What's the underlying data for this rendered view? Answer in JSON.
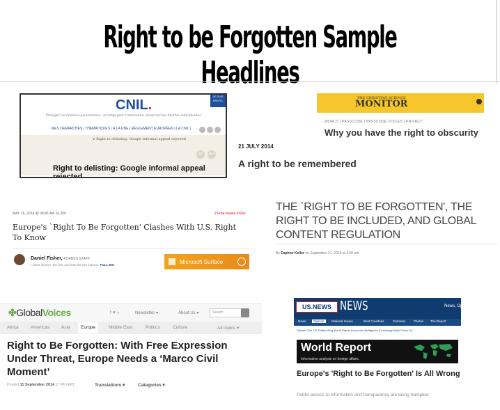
{
  "title": "Right to be Forgotten Sample Headlines",
  "cnil": {
    "logo": "CNIL",
    "logo_dot": ".",
    "corner_text": "JE SUIS PARTIC",
    "tagline": "Protéger les données personnelles, accompagner l'innovation, préserver les libertés individuelles",
    "nav": "MES DÉMARCHES | THÉMATIQUES | À LA UNE | RÈGLEMENT EUROPÉEN | LA CNIL |",
    "breadcrumb": "▸ Right to delisting: Google informal appeal rejected",
    "font_minus": "A-",
    "font_plus": "A+",
    "headline": "Right to delisting: Google informal appeal rejected"
  },
  "csm": {
    "logo_small": "THE CHRISTIAN SCIENCE",
    "logo": "MONITOR",
    "nav": "WORLD | PASSCODE | PASSCODE VOICES | PRIVACY",
    "headline": "Why you have the right to obscurity",
    "brand_color": "#f7c62a"
  },
  "standalone": {
    "date": "21 JULY 2014",
    "headline": "A right to be remembered"
  },
  "forbes": {
    "meta": "MAY 16, 2014 @ 08:45 AM    16,306",
    "free": "2 Free Issues of For",
    "headline": "Europe's `Right To Be Forgotten' Clashes With U.S. Right To Know",
    "author": "Daniel Fisher,",
    "staff": "FORBES STAFF",
    "bio": "I cover finance, the law, and how the two interact.",
    "bio_link": "FULL BIO",
    "ad": "Microsoft Surface"
  },
  "daphne": {
    "headline": "THE `RIGHT TO BE FORGOTTEN', THE RIGHT TO BE INCLUDED, AND GLOBAL CONTENT REGULATION",
    "by_prefix": "By",
    "author": "Daphne Keller",
    "date": "on September 21, 2018 at 4:00 pm"
  },
  "globalvoices": {
    "logo_a": "Global",
    "logo_b": "Voices",
    "social": "f  ♥  ◗",
    "newsletter": "Newsletter ▾",
    "about": "About Us ▾",
    "search_placeholder": "Search",
    "tabs": [
      "Africa",
      "Americas",
      "Asia",
      "Europe",
      "Middle East",
      "Politics",
      "Culture",
      "All topics ▾"
    ],
    "headline": "Right to Be Forgotten: With Free Expression Under Threat, Europe Needs a ‘Marco Civil Moment’",
    "posted": "Posted",
    "date": "11 September 2014",
    "time": "17:45 GMT",
    "translations": "Translations ▾",
    "categories": "Categories ▾",
    "accent": "#6ab04c"
  },
  "usnews": {
    "logo1": "US.NEWS",
    "logo2": "NEWS",
    "right": "News, Op",
    "nav": [
      "News",
      "Opinion",
      "National Issues",
      "Best Countries",
      "Cartoons",
      "Photos",
      "The Report"
    ],
    "sub": "Debate Club    TIS Politics Blog    World Report    Economic Intelligence    Knowledge Bank    Policy Da",
    "wr_title": "World Report",
    "wr_sub": "Informative analysis on foreign affairs.",
    "headline": "Europe's 'Right to Be Forgotten' Is All Wrong",
    "subhead": "Public access to information and transparency are being trampled.",
    "brand_color": "#103b6f"
  }
}
